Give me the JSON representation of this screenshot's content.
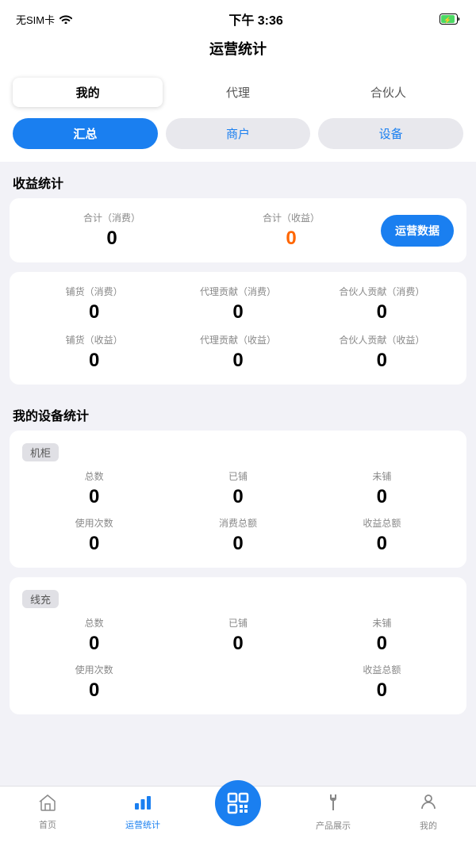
{
  "statusBar": {
    "carrier": "无SIM卡",
    "time": "下午 3:36",
    "battery": "charging"
  },
  "pageTitle": "运营统计",
  "tabs1": {
    "items": [
      {
        "label": "我的",
        "active": true
      },
      {
        "label": "代理",
        "active": false
      },
      {
        "label": "合伙人",
        "active": false
      }
    ]
  },
  "tabs2": {
    "items": [
      {
        "label": "汇总",
        "active": true,
        "style": "active"
      },
      {
        "label": "商户",
        "active": false,
        "style": "blue-text"
      },
      {
        "label": "设备",
        "active": false,
        "style": "blue-text"
      }
    ]
  },
  "revenueSection": {
    "title": "收益统计",
    "card1": {
      "col1Label": "合计（消费）",
      "col1Value": "0",
      "col2Label": "合计（收益）",
      "col2Value": "0",
      "btnLabel": "运营数据"
    },
    "card2": {
      "cells": [
        {
          "label": "铺货（消费）",
          "value": "0"
        },
        {
          "label": "代理贡献（消费）",
          "value": "0"
        },
        {
          "label": "合伙人贡献（消费）",
          "value": "0"
        },
        {
          "label": "铺货（收益）",
          "value": "0"
        },
        {
          "label": "代理贡献（收益）",
          "value": "0"
        },
        {
          "label": "合伙人贡献（收益）",
          "value": "0"
        }
      ]
    }
  },
  "deviceSection": {
    "title": "我的设备统计",
    "card1": {
      "deviceType": "机柜",
      "rows": [
        [
          {
            "label": "总数",
            "value": "0"
          },
          {
            "label": "已铺",
            "value": "0"
          },
          {
            "label": "未铺",
            "value": "0"
          }
        ],
        [
          {
            "label": "使用次数",
            "value": "0"
          },
          {
            "label": "消费总额",
            "value": "0"
          },
          {
            "label": "收益总额",
            "value": "0"
          }
        ]
      ]
    },
    "card2": {
      "deviceType": "线充",
      "rows": [
        [
          {
            "label": "总数",
            "value": "0"
          },
          {
            "label": "已铺",
            "value": "0"
          },
          {
            "label": "未铺",
            "value": "0"
          }
        ],
        [
          {
            "label": "使用次数",
            "value": "0"
          },
          {
            "label": "",
            "value": ""
          },
          {
            "label": "收益总额",
            "value": "0"
          }
        ]
      ]
    }
  },
  "bottomNav": {
    "items": [
      {
        "label": "首页",
        "icon": "home",
        "active": false
      },
      {
        "label": "运营统计",
        "icon": "chart",
        "active": true
      },
      {
        "label": "扫码",
        "icon": "scan",
        "active": false,
        "special": true
      },
      {
        "label": "产品展示",
        "icon": "fork",
        "active": false
      },
      {
        "label": "我的",
        "icon": "person",
        "active": false
      }
    ]
  }
}
